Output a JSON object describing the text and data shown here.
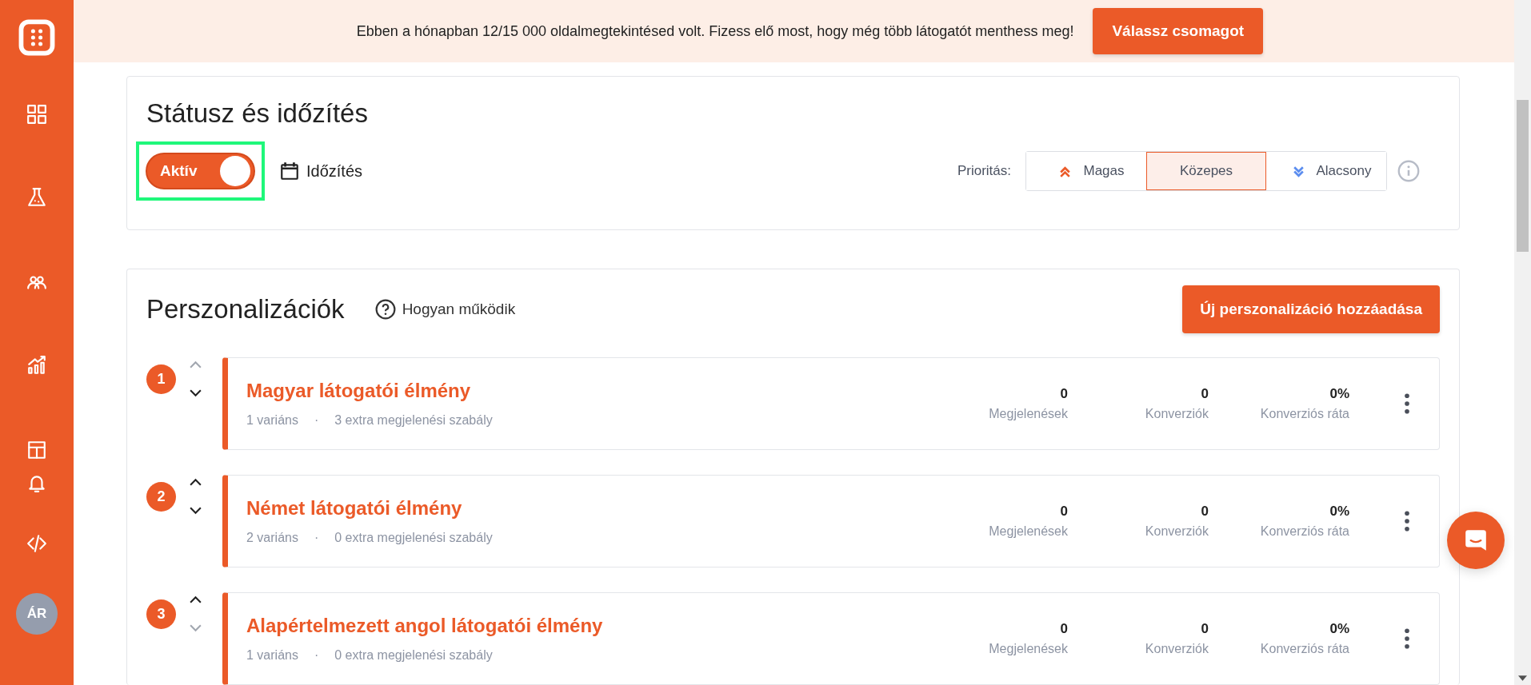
{
  "sidebar": {
    "avatar_initials": "ÁR"
  },
  "banner": {
    "message": "Ebben a hónapban 12/15 000 oldalmegtekintésed volt. Fizess elő most, hogy még több látogatót menthess meg!",
    "button": "Válassz csomagot"
  },
  "status_section": {
    "title": "Státusz és időzítés",
    "status_toggle": {
      "label": "Aktív",
      "on": true,
      "highlighted": true
    },
    "schedule_label": "Időzítés",
    "priority": {
      "label": "Prioritás:",
      "options": [
        {
          "label": "Magas",
          "kind": "high",
          "selected": false
        },
        {
          "label": "Közepes",
          "kind": "medium",
          "selected": true
        },
        {
          "label": "Alacsony",
          "kind": "low",
          "selected": false
        }
      ]
    }
  },
  "personalizations": {
    "title": "Perszonalizációk",
    "help_link": "Hogyan működik",
    "add_button": "Új perszonalizáció hozzáadása",
    "items": [
      {
        "number": "1",
        "name": "Magyar látogatói élmény",
        "variants": "1 variáns",
        "separator": "·",
        "rules": "3 extra megjelenési szabály",
        "move_up_disabled": true,
        "move_down_disabled": false,
        "stats": [
          {
            "value": "0",
            "label": "Megjelenések"
          },
          {
            "value": "0",
            "label": "Konverziók"
          },
          {
            "value": "0%",
            "label": "Konverziós ráta"
          }
        ]
      },
      {
        "number": "2",
        "name": "Német látogatói élmény",
        "variants": "2 variáns",
        "separator": "·",
        "rules": "0 extra megjelenési szabály",
        "move_up_disabled": false,
        "move_down_disabled": false,
        "stats": [
          {
            "value": "0",
            "label": "Megjelenések"
          },
          {
            "value": "0",
            "label": "Konverziók"
          },
          {
            "value": "0%",
            "label": "Konverziós ráta"
          }
        ]
      },
      {
        "number": "3",
        "name": "Alapértelmezett angol látogatói élmény",
        "variants": "1 variáns",
        "separator": "·",
        "rules": "0 extra megjelenési szabály",
        "move_up_disabled": false,
        "move_down_disabled": true,
        "stats": [
          {
            "value": "0",
            "label": "Megjelenések"
          },
          {
            "value": "0",
            "label": "Konverziók"
          },
          {
            "value": "0%",
            "label": "Konverziós ráta"
          }
        ]
      }
    ]
  }
}
